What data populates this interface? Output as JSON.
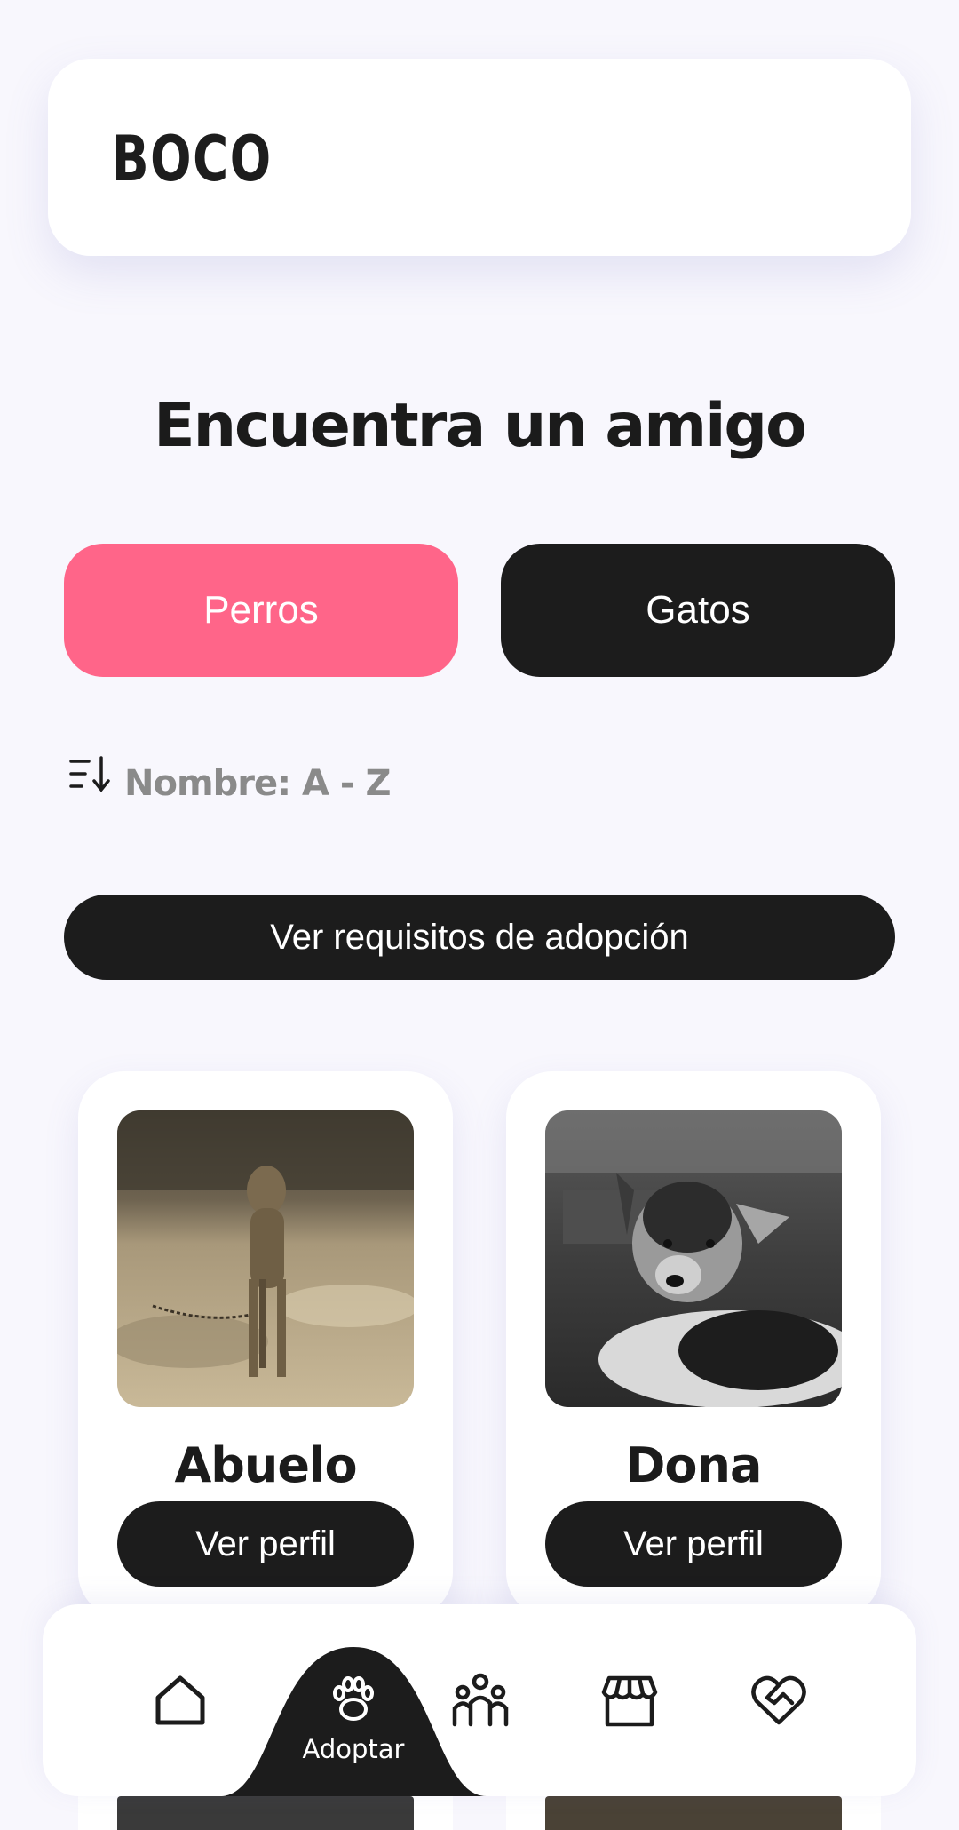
{
  "header": {
    "logo": "BOCO"
  },
  "page": {
    "title": "Encuentra un amigo"
  },
  "tabs": [
    {
      "label": "Perros",
      "active": true
    },
    {
      "label": "Gatos",
      "active": false
    }
  ],
  "sort": {
    "label": "Nombre: A - Z",
    "icon": "sort-descending-icon"
  },
  "requirements_button": "Ver requisitos de adopción",
  "pets": [
    {
      "name": "Abuelo",
      "button": "Ver perfil",
      "photo": "dog-photo"
    },
    {
      "name": "Dona",
      "button": "Ver perfil",
      "photo": "dog-photo"
    }
  ],
  "bottom_nav": {
    "items": [
      {
        "icon": "home-icon"
      },
      {
        "icon": "paw-icon",
        "label": "Adoptar",
        "active": true
      },
      {
        "icon": "community-icon"
      },
      {
        "icon": "store-icon"
      },
      {
        "icon": "heart-handshake-icon"
      }
    ]
  },
  "colors": {
    "accent": "#ff6589",
    "dark": "#1c1c1c",
    "background": "#f8f7fd"
  }
}
